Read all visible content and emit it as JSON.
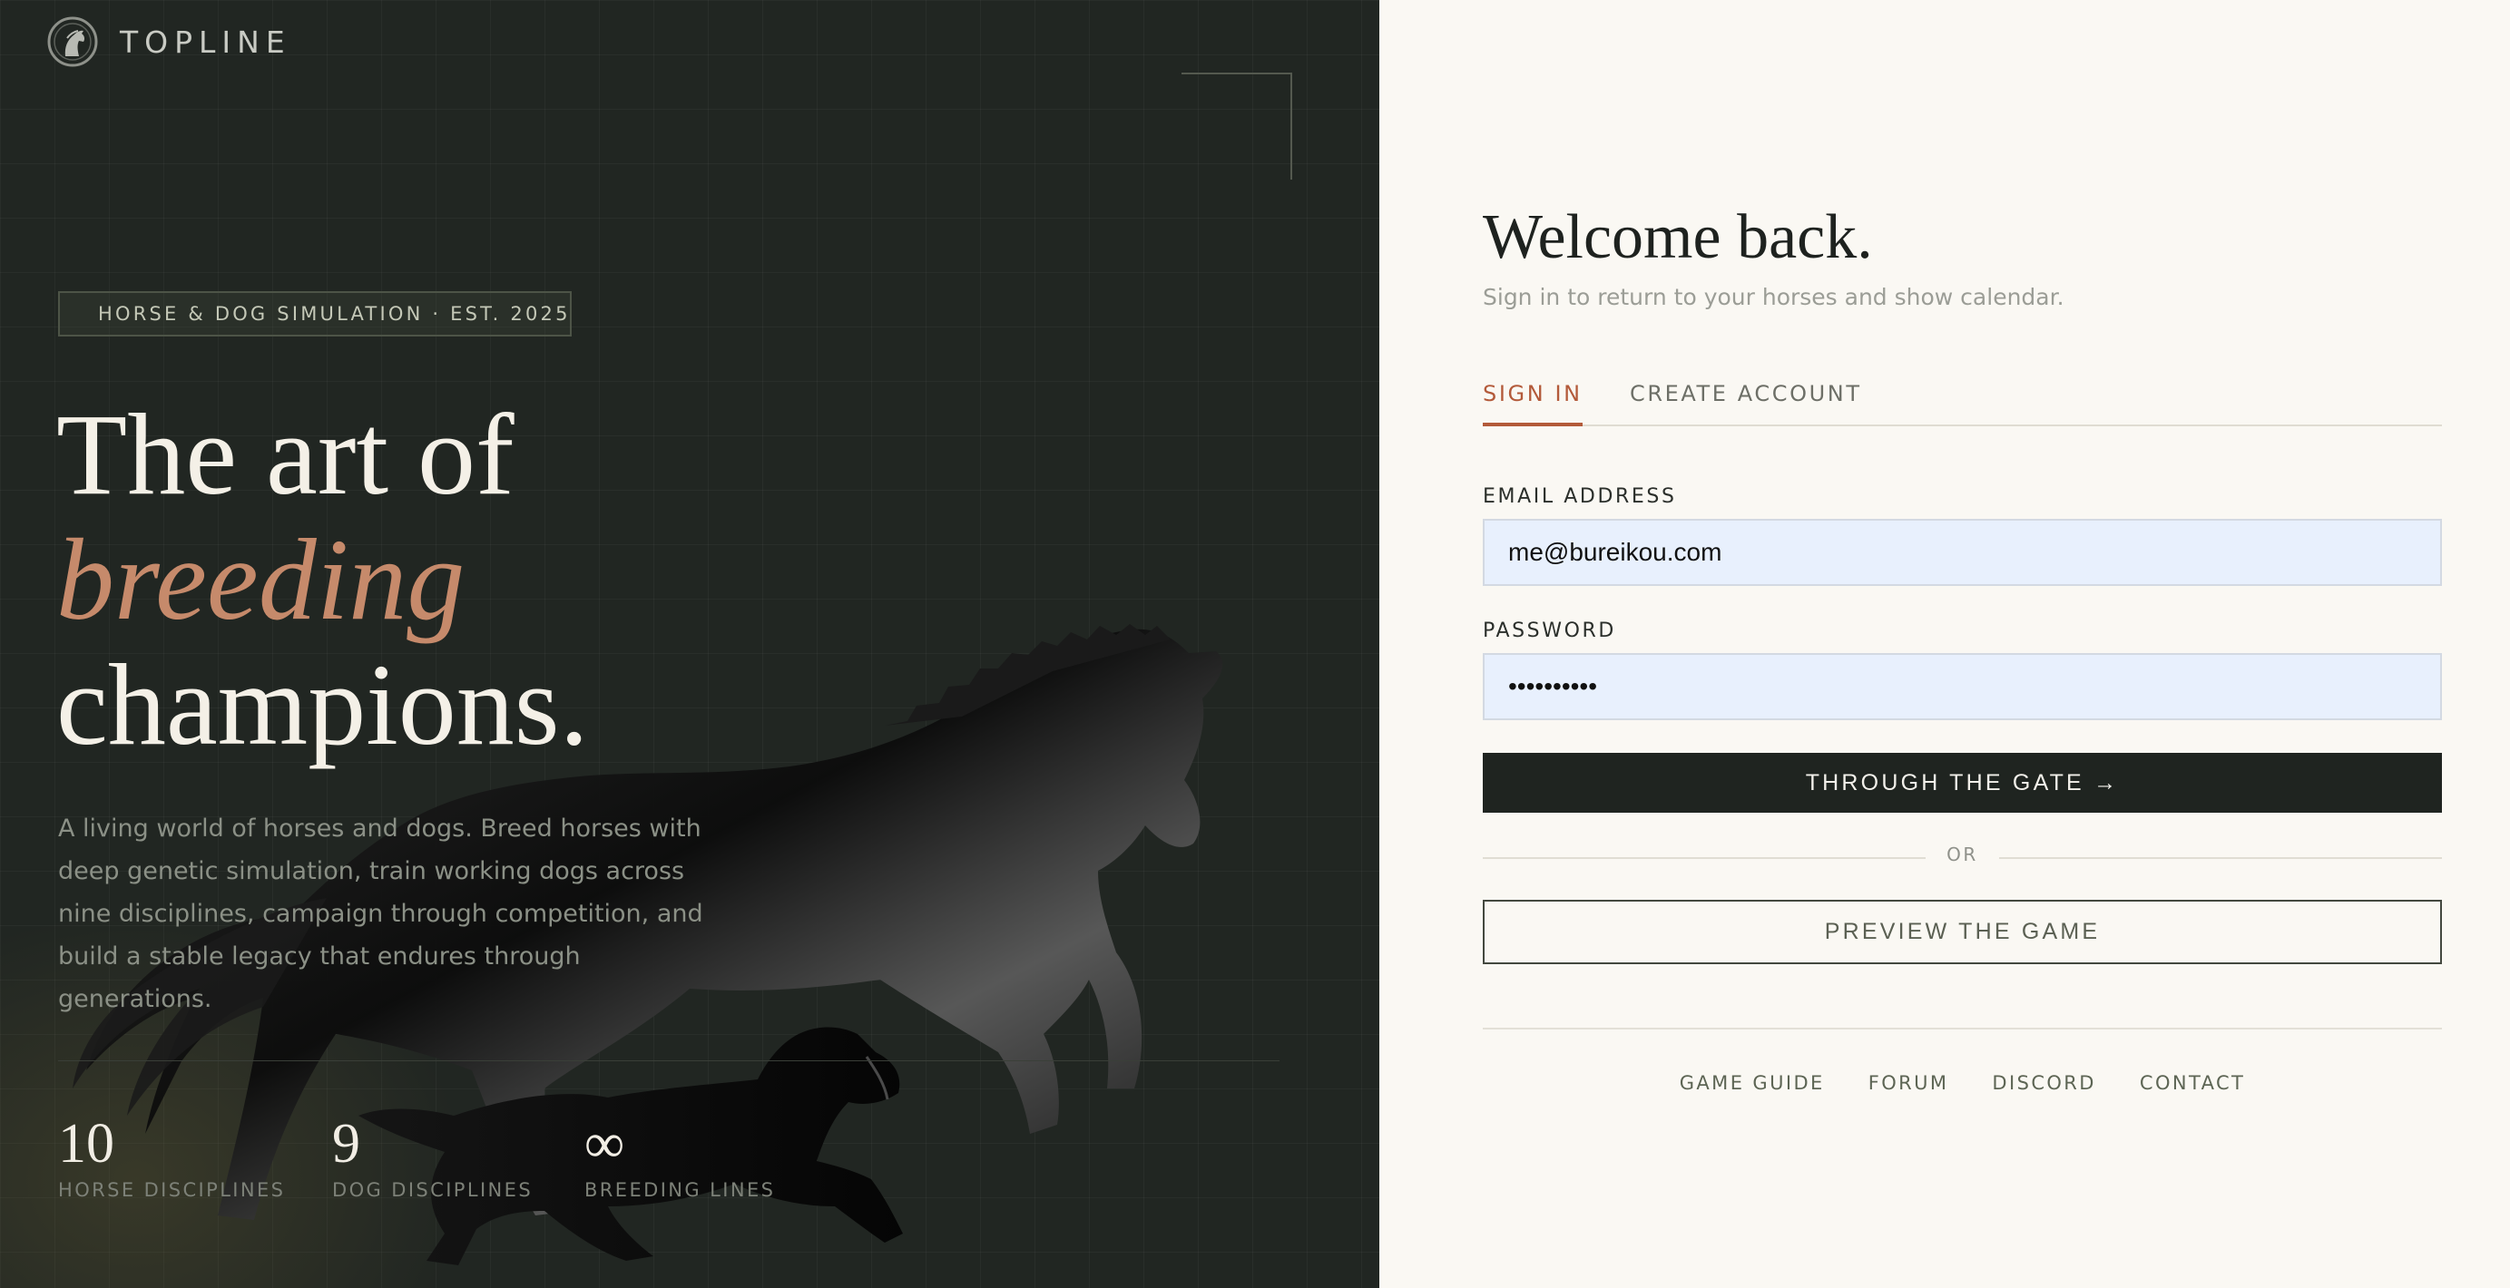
{
  "brand": {
    "name": "TOPLINE"
  },
  "hero": {
    "tag": "HORSE & DOG SIMULATION · EST. 2025",
    "headline": {
      "line1": "The art of",
      "accent": "breeding",
      "line3": "champions."
    },
    "lede": "A living world of horses and dogs. Breed horses with deep genetic simulation, train working dogs across nine disciplines, campaign through competition, and build a stable legacy that endures through generations.",
    "stats": [
      {
        "value": "10",
        "label": "HORSE DISCIPLINES"
      },
      {
        "value": "9",
        "label": "DOG DISCIPLINES"
      },
      {
        "value": "∞",
        "label": "BREEDING LINES"
      }
    ]
  },
  "auth": {
    "title": "Welcome back.",
    "subtitle": "Sign in to return to your horses and show calendar.",
    "tabs": [
      {
        "label": "SIGN IN",
        "active": true
      },
      {
        "label": "CREATE ACCOUNT",
        "active": false
      }
    ],
    "email": {
      "label": "EMAIL ADDRESS",
      "value": "me@bureikou.com"
    },
    "password": {
      "label": "PASSWORD",
      "value": "••••••••••"
    },
    "submit": "THROUGH THE GATE →",
    "divider": "OR",
    "preview": "PREVIEW THE GAME",
    "footer": [
      "GAME GUIDE",
      "FORUM",
      "DISCORD",
      "CONTACT"
    ]
  },
  "colors": {
    "accent": "#b35a3a",
    "hero_bg": "#212622",
    "panel_bg": "#faf8f3",
    "headline_accent": "#c68a6b",
    "input_bg": "#e8f0fd"
  }
}
